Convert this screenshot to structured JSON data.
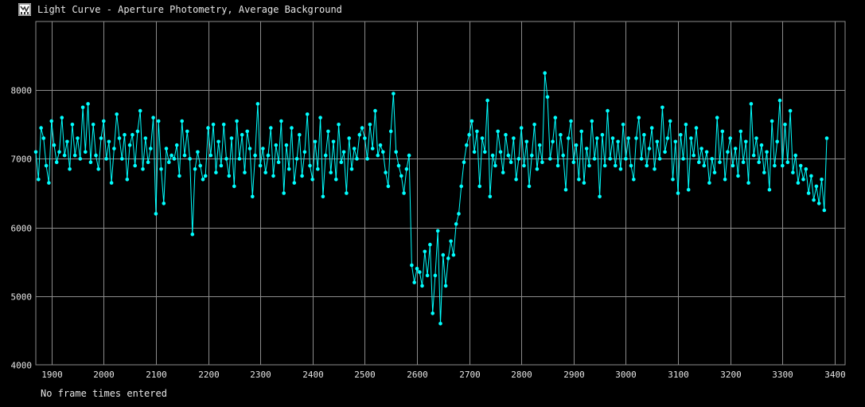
{
  "window": {
    "title": "Light Curve - Aperture Photometry, Average Background",
    "icon": "light-curve-app-icon"
  },
  "status_text": "No frame times entered",
  "colors": {
    "background": "#000000",
    "grid": "#8c8c8c",
    "series": "#00ffff",
    "text": "#e6e6e6"
  },
  "chart_data": {
    "type": "line",
    "title": "",
    "xlabel": "",
    "ylabel": "",
    "xlim": [
      1870,
      3420
    ],
    "ylim": [
      4000,
      9000
    ],
    "xticks": [
      1900,
      2000,
      2100,
      2200,
      2300,
      2400,
      2500,
      2600,
      2700,
      2800,
      2900,
      3000,
      3100,
      3200,
      3300,
      3400
    ],
    "yticks": [
      4000,
      5000,
      6000,
      7000,
      8000
    ],
    "grid": true,
    "legend": "none",
    "markers": true,
    "series": [
      {
        "values": [
          [
            1870,
            7100
          ],
          [
            1875,
            6700
          ],
          [
            1880,
            7450
          ],
          [
            1885,
            7300
          ],
          [
            1890,
            6900
          ],
          [
            1895,
            6650
          ],
          [
            1900,
            7550
          ],
          [
            1905,
            7200
          ],
          [
            1910,
            6950
          ],
          [
            1915,
            7100
          ],
          [
            1920,
            7600
          ],
          [
            1925,
            7050
          ],
          [
            1930,
            7250
          ],
          [
            1935,
            6850
          ],
          [
            1940,
            7500
          ],
          [
            1945,
            7050
          ],
          [
            1950,
            7300
          ],
          [
            1955,
            7000
          ],
          [
            1960,
            7750
          ],
          [
            1965,
            7100
          ],
          [
            1970,
            7800
          ],
          [
            1975,
            6950
          ],
          [
            1980,
            7500
          ],
          [
            1985,
            7050
          ],
          [
            1990,
            6850
          ],
          [
            1995,
            7300
          ],
          [
            2000,
            7550
          ],
          [
            2005,
            7000
          ],
          [
            2010,
            7250
          ],
          [
            2015,
            6650
          ],
          [
            2020,
            7150
          ],
          [
            2025,
            7650
          ],
          [
            2030,
            7300
          ],
          [
            2035,
            7000
          ],
          [
            2040,
            7350
          ],
          [
            2045,
            6700
          ],
          [
            2050,
            7200
          ],
          [
            2055,
            7350
          ],
          [
            2060,
            6900
          ],
          [
            2065,
            7400
          ],
          [
            2070,
            7700
          ],
          [
            2075,
            6850
          ],
          [
            2080,
            7300
          ],
          [
            2085,
            6950
          ],
          [
            2090,
            7150
          ],
          [
            2095,
            7600
          ],
          [
            2100,
            6200
          ],
          [
            2105,
            7550
          ],
          [
            2110,
            6850
          ],
          [
            2115,
            6350
          ],
          [
            2120,
            7150
          ],
          [
            2125,
            6950
          ],
          [
            2130,
            7050
          ],
          [
            2135,
            7000
          ],
          [
            2140,
            7200
          ],
          [
            2145,
            6750
          ],
          [
            2150,
            7550
          ],
          [
            2155,
            7050
          ],
          [
            2160,
            7400
          ],
          [
            2165,
            7000
          ],
          [
            2170,
            5900
          ],
          [
            2175,
            6850
          ],
          [
            2180,
            7100
          ],
          [
            2185,
            6900
          ],
          [
            2190,
            6700
          ],
          [
            2195,
            6750
          ],
          [
            2200,
            7450
          ],
          [
            2205,
            7050
          ],
          [
            2210,
            7500
          ],
          [
            2215,
            6800
          ],
          [
            2220,
            7250
          ],
          [
            2225,
            6900
          ],
          [
            2230,
            7500
          ],
          [
            2235,
            7000
          ],
          [
            2240,
            6750
          ],
          [
            2245,
            7300
          ],
          [
            2250,
            6600
          ],
          [
            2255,
            7550
          ],
          [
            2260,
            7000
          ],
          [
            2265,
            7350
          ],
          [
            2270,
            6800
          ],
          [
            2275,
            7400
          ],
          [
            2280,
            7150
          ],
          [
            2285,
            6450
          ],
          [
            2290,
            7050
          ],
          [
            2295,
            7800
          ],
          [
            2300,
            6900
          ],
          [
            2305,
            7150
          ],
          [
            2310,
            6800
          ],
          [
            2315,
            7050
          ],
          [
            2320,
            7450
          ],
          [
            2325,
            6750
          ],
          [
            2330,
            7200
          ],
          [
            2335,
            6950
          ],
          [
            2340,
            7550
          ],
          [
            2345,
            6500
          ],
          [
            2350,
            7200
          ],
          [
            2355,
            6850
          ],
          [
            2360,
            7450
          ],
          [
            2365,
            6650
          ],
          [
            2370,
            7000
          ],
          [
            2375,
            7350
          ],
          [
            2380,
            6750
          ],
          [
            2385,
            7100
          ],
          [
            2390,
            7650
          ],
          [
            2395,
            6900
          ],
          [
            2400,
            6700
          ],
          [
            2405,
            7250
          ],
          [
            2410,
            6850
          ],
          [
            2415,
            7600
          ],
          [
            2420,
            6450
          ],
          [
            2425,
            7050
          ],
          [
            2430,
            7400
          ],
          [
            2435,
            6800
          ],
          [
            2440,
            7250
          ],
          [
            2445,
            6700
          ],
          [
            2450,
            7500
          ],
          [
            2455,
            6950
          ],
          [
            2460,
            7100
          ],
          [
            2465,
            6500
          ],
          [
            2470,
            7300
          ],
          [
            2475,
            6850
          ],
          [
            2480,
            7150
          ],
          [
            2485,
            7000
          ],
          [
            2490,
            7350
          ],
          [
            2495,
            7450
          ],
          [
            2500,
            7300
          ],
          [
            2505,
            7000
          ],
          [
            2510,
            7500
          ],
          [
            2515,
            7150
          ],
          [
            2520,
            7700
          ],
          [
            2525,
            7050
          ],
          [
            2530,
            7200
          ],
          [
            2535,
            7100
          ],
          [
            2540,
            6800
          ],
          [
            2545,
            6600
          ],
          [
            2550,
            7400
          ],
          [
            2555,
            7950
          ],
          [
            2560,
            7100
          ],
          [
            2565,
            6900
          ],
          [
            2570,
            6750
          ],
          [
            2575,
            6500
          ],
          [
            2580,
            6850
          ],
          [
            2585,
            7050
          ],
          [
            2590,
            5450
          ],
          [
            2595,
            5200
          ],
          [
            2600,
            5400
          ],
          [
            2605,
            5350
          ],
          [
            2610,
            5150
          ],
          [
            2615,
            5650
          ],
          [
            2620,
            5300
          ],
          [
            2625,
            5750
          ],
          [
            2630,
            4750
          ],
          [
            2635,
            5300
          ],
          [
            2640,
            5950
          ],
          [
            2645,
            4600
          ],
          [
            2650,
            5600
          ],
          [
            2655,
            5150
          ],
          [
            2660,
            5550
          ],
          [
            2665,
            5800
          ],
          [
            2670,
            5600
          ],
          [
            2675,
            6050
          ],
          [
            2680,
            6200
          ],
          [
            2685,
            6600
          ],
          [
            2690,
            6950
          ],
          [
            2695,
            7200
          ],
          [
            2700,
            7350
          ],
          [
            2705,
            7550
          ],
          [
            2710,
            7100
          ],
          [
            2715,
            7400
          ],
          [
            2720,
            6600
          ],
          [
            2725,
            7300
          ],
          [
            2730,
            7100
          ],
          [
            2735,
            7850
          ],
          [
            2740,
            6450
          ],
          [
            2745,
            7050
          ],
          [
            2750,
            6900
          ],
          [
            2755,
            7400
          ],
          [
            2760,
            7100
          ],
          [
            2765,
            6800
          ],
          [
            2770,
            7350
          ],
          [
            2775,
            7050
          ],
          [
            2780,
            6950
          ],
          [
            2785,
            7300
          ],
          [
            2790,
            6700
          ],
          [
            2795,
            7000
          ],
          [
            2800,
            7450
          ],
          [
            2805,
            6900
          ],
          [
            2810,
            7250
          ],
          [
            2815,
            6600
          ],
          [
            2820,
            7050
          ],
          [
            2825,
            7500
          ],
          [
            2830,
            6850
          ],
          [
            2835,
            7200
          ],
          [
            2840,
            6950
          ],
          [
            2845,
            8250
          ],
          [
            2850,
            7900
          ],
          [
            2855,
            7000
          ],
          [
            2860,
            7250
          ],
          [
            2865,
            7600
          ],
          [
            2870,
            6900
          ],
          [
            2875,
            7350
          ],
          [
            2880,
            7050
          ],
          [
            2885,
            6550
          ],
          [
            2890,
            7300
          ],
          [
            2895,
            7550
          ],
          [
            2900,
            6950
          ],
          [
            2905,
            7200
          ],
          [
            2910,
            6700
          ],
          [
            2915,
            7400
          ],
          [
            2920,
            6650
          ],
          [
            2925,
            7150
          ],
          [
            2930,
            6900
          ],
          [
            2935,
            7550
          ],
          [
            2940,
            7000
          ],
          [
            2945,
            7300
          ],
          [
            2950,
            6450
          ],
          [
            2955,
            7350
          ],
          [
            2960,
            6900
          ],
          [
            2965,
            7700
          ],
          [
            2970,
            7000
          ],
          [
            2975,
            7300
          ],
          [
            2980,
            6900
          ],
          [
            2985,
            7250
          ],
          [
            2990,
            6850
          ],
          [
            2995,
            7500
          ],
          [
            3000,
            7000
          ],
          [
            3005,
            7300
          ],
          [
            3010,
            6900
          ],
          [
            3015,
            6700
          ],
          [
            3020,
            7300
          ],
          [
            3025,
            7600
          ],
          [
            3030,
            7000
          ],
          [
            3035,
            7350
          ],
          [
            3040,
            6900
          ],
          [
            3045,
            7150
          ],
          [
            3050,
            7450
          ],
          [
            3055,
            6850
          ],
          [
            3060,
            7250
          ],
          [
            3065,
            7000
          ],
          [
            3070,
            7750
          ],
          [
            3075,
            7100
          ],
          [
            3080,
            7300
          ],
          [
            3085,
            7550
          ],
          [
            3090,
            6700
          ],
          [
            3095,
            7250
          ],
          [
            3100,
            6500
          ],
          [
            3105,
            7350
          ],
          [
            3110,
            7000
          ],
          [
            3115,
            7500
          ],
          [
            3120,
            6550
          ],
          [
            3125,
            7300
          ],
          [
            3130,
            7050
          ],
          [
            3135,
            7450
          ],
          [
            3140,
            6950
          ],
          [
            3145,
            7150
          ],
          [
            3150,
            6900
          ],
          [
            3155,
            7100
          ],
          [
            3160,
            6650
          ],
          [
            3165,
            7000
          ],
          [
            3170,
            6800
          ],
          [
            3175,
            7600
          ],
          [
            3180,
            6950
          ],
          [
            3185,
            7400
          ],
          [
            3190,
            6700
          ],
          [
            3195,
            7100
          ],
          [
            3200,
            7300
          ],
          [
            3205,
            6900
          ],
          [
            3210,
            7150
          ],
          [
            3215,
            6750
          ],
          [
            3220,
            7400
          ],
          [
            3225,
            6950
          ],
          [
            3230,
            7250
          ],
          [
            3235,
            6650
          ],
          [
            3240,
            7800
          ],
          [
            3245,
            7050
          ],
          [
            3250,
            7300
          ],
          [
            3255,
            6950
          ],
          [
            3260,
            7200
          ],
          [
            3265,
            6800
          ],
          [
            3270,
            7100
          ],
          [
            3275,
            6550
          ],
          [
            3280,
            7550
          ],
          [
            3285,
            6900
          ],
          [
            3290,
            7250
          ],
          [
            3295,
            7850
          ],
          [
            3300,
            6900
          ],
          [
            3305,
            7500
          ],
          [
            3310,
            6950
          ],
          [
            3315,
            7700
          ],
          [
            3320,
            6800
          ],
          [
            3325,
            7050
          ],
          [
            3330,
            6650
          ],
          [
            3335,
            6900
          ],
          [
            3340,
            6700
          ],
          [
            3345,
            6850
          ],
          [
            3350,
            6500
          ],
          [
            3355,
            6750
          ],
          [
            3360,
            6400
          ],
          [
            3365,
            6600
          ],
          [
            3370,
            6350
          ],
          [
            3375,
            6700
          ],
          [
            3380,
            6250
          ],
          [
            3385,
            7300
          ]
        ]
      }
    ]
  }
}
